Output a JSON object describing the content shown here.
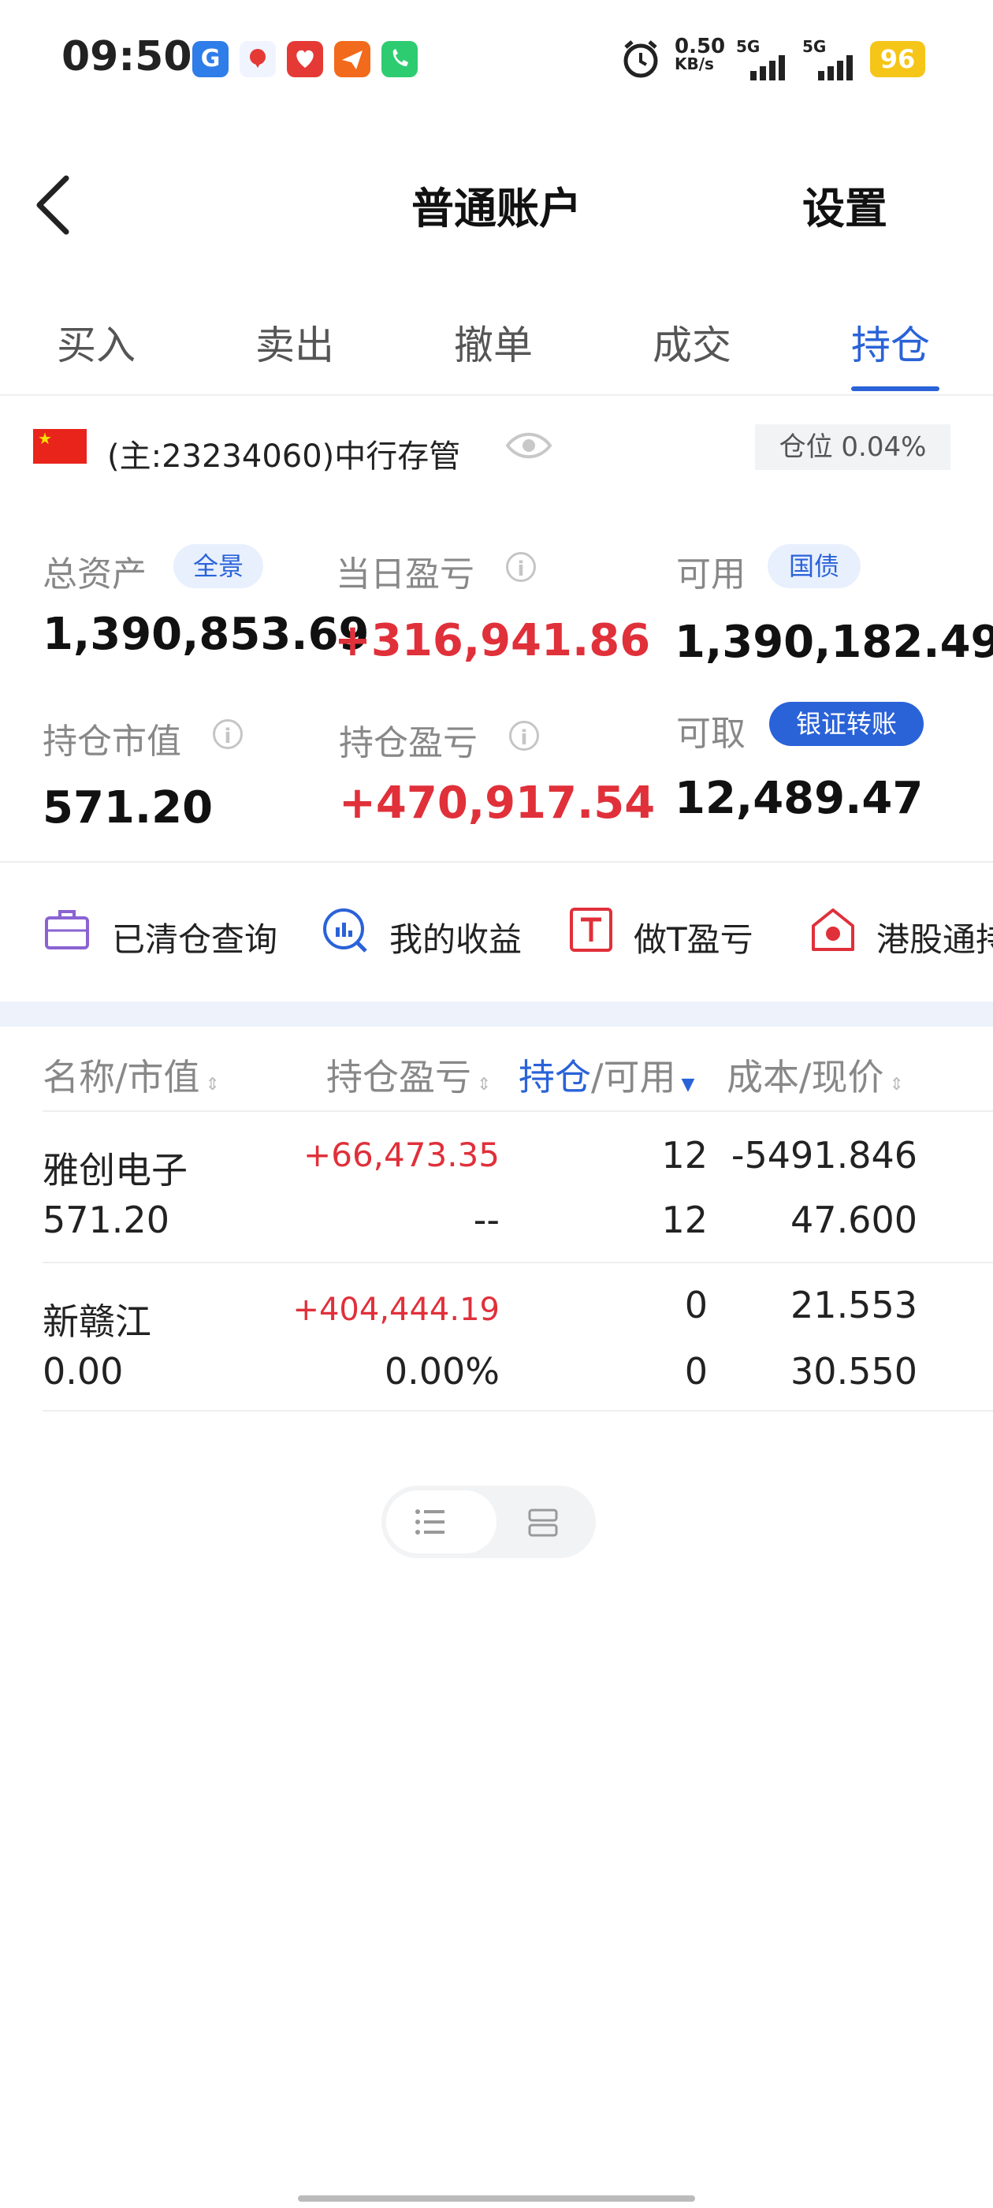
{
  "status_bar": {
    "time": "09:50",
    "net_speed": "0.50",
    "net_unit": "KB/s",
    "signal1": "5G",
    "signal2": "5G",
    "battery": "96"
  },
  "header": {
    "title": "普通账户",
    "settings": "设置"
  },
  "tabs": [
    {
      "label": "买入"
    },
    {
      "label": "卖出"
    },
    {
      "label": "撤单"
    },
    {
      "label": "成交"
    },
    {
      "label": "持仓"
    }
  ],
  "active_tab": "持仓",
  "account": {
    "label": "(主:23234060)中行存管",
    "position_ratio": "仓位 0.04%"
  },
  "summary": {
    "total_assets_label": "总资产",
    "total_assets_badge": "全景",
    "total_assets": "1,390,853.69",
    "daily_pnl_label": "当日盈亏",
    "daily_pnl": "+316,941.86",
    "available_label": "可用",
    "available_badge": "国债",
    "available": "1,390,182.49",
    "market_value_label": "持仓市值",
    "market_value": "571.20",
    "position_pnl_label": "持仓盈亏",
    "position_pnl": "+470,917.54",
    "withdrawable_label": "可取",
    "withdrawable_badge": "银证转账",
    "withdrawable": "12,489.47"
  },
  "tools": [
    {
      "label": "已清仓查询",
      "icon": "briefcase-icon"
    },
    {
      "label": "我的收益",
      "icon": "chart-search-icon"
    },
    {
      "label": "做T盈亏",
      "icon": "t-box-icon"
    },
    {
      "label": "港股通持",
      "icon": "hk-home-icon"
    }
  ],
  "table": {
    "headers": {
      "name": "名称/市值",
      "pnl": "持仓盈亏",
      "hold_a": "持仓",
      "hold_b": "/可用",
      "cost": "成本/现价"
    },
    "rows": [
      {
        "name": "雅创电子",
        "market_value": "571.20",
        "pnl": "+66,473.35",
        "pnl_pct": "--",
        "hold": "12",
        "available": "12",
        "cost": "-5491.846",
        "price": "47.600"
      },
      {
        "name": "新赣江",
        "market_value": "0.00",
        "pnl": "+404,444.19",
        "pnl_pct": "0.00%",
        "hold": "0",
        "available": "0",
        "cost": "21.553",
        "price": "30.550"
      }
    ]
  },
  "colors": {
    "accent": "#2a62d8",
    "profit": "#e0303a"
  }
}
